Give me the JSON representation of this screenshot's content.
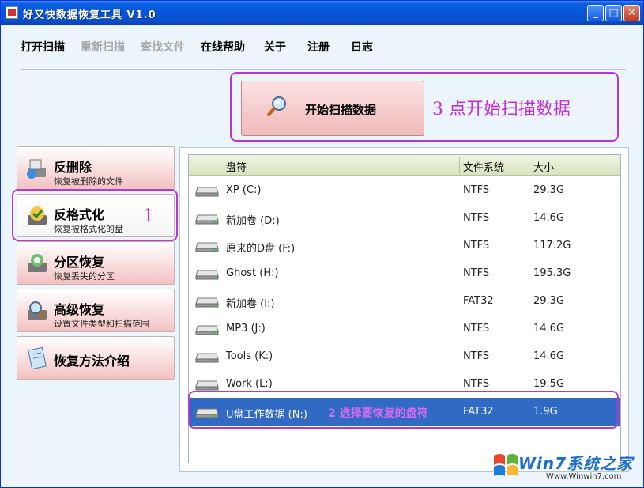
{
  "window": {
    "title": "好又快数据恢复工具 V1.0",
    "controls": {
      "minimize": "_",
      "maximize": "□",
      "close": "✕"
    }
  },
  "menu": [
    {
      "label": "打开扫描",
      "enabled": true
    },
    {
      "label": "重新扫描",
      "enabled": false
    },
    {
      "label": "查找文件",
      "enabled": false
    },
    {
      "label": "在线帮助",
      "enabled": true
    },
    {
      "label": "关于",
      "enabled": true
    },
    {
      "label": "注册",
      "enabled": true
    },
    {
      "label": "日志",
      "enabled": true
    }
  ],
  "scan_button": {
    "label": "开始扫描数据",
    "icon": "magnifier-icon"
  },
  "annotations": {
    "step1": "1",
    "step2": "2 选择要恢复的盘符",
    "step3": "3 点开始扫描数据",
    "color": "#c12fd6"
  },
  "sidebar": [
    {
      "title": "反删除",
      "subtitle": "恢复被删除的文件",
      "icon": "undelete-icon"
    },
    {
      "title": "反格式化",
      "subtitle": "恢复被格式化的盘",
      "icon": "unformat-icon",
      "active": true
    },
    {
      "title": "分区恢复",
      "subtitle": "恢复丢失的分区",
      "icon": "partition-icon"
    },
    {
      "title": "高级恢复",
      "subtitle": "设置文件类型和扫描范围",
      "icon": "advanced-icon"
    },
    {
      "title": "恢复方法介绍",
      "subtitle": "",
      "icon": "guide-icon"
    }
  ],
  "drive_table": {
    "columns": [
      "盘符",
      "文件系统",
      "大小"
    ],
    "rows": [
      {
        "name": "XP (C:)",
        "fs": "NTFS",
        "size": "29.3G"
      },
      {
        "name": "新加卷 (D:)",
        "fs": "NTFS",
        "size": "14.6G"
      },
      {
        "name": "原来的D盘 (F:)",
        "fs": "NTFS",
        "size": "117.2G"
      },
      {
        "name": "Ghost (H:)",
        "fs": "NTFS",
        "size": "195.3G"
      },
      {
        "name": "新加卷 (I:)",
        "fs": "FAT32",
        "size": "29.3G"
      },
      {
        "name": "MP3 (J:)",
        "fs": "NTFS",
        "size": "14.6G"
      },
      {
        "name": "Tools (K:)",
        "fs": "NTFS",
        "size": "14.6G"
      },
      {
        "name": "Work (L:)",
        "fs": "NTFS",
        "size": "19.5G"
      },
      {
        "name": "U盘工作数据 (N:)",
        "fs": "FAT32",
        "size": "1.9G",
        "selected": true
      }
    ]
  },
  "watermark": {
    "text": "Win7系统之家",
    "url": "Www.Winwin7.com"
  },
  "colors": {
    "selection": "#316ac5",
    "titlebar": "#0555d8",
    "annotation": "#c12fd6"
  }
}
